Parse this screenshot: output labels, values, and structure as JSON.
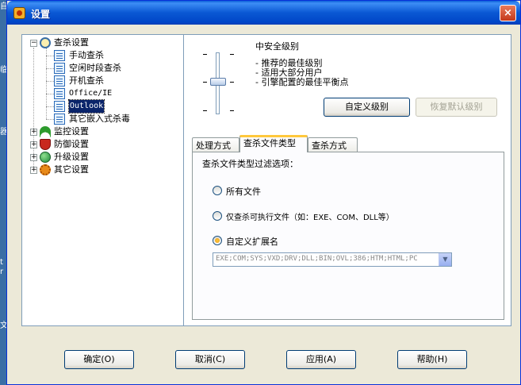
{
  "window": {
    "title": "设置",
    "close_label": "×"
  },
  "tree": {
    "items": [
      {
        "label": "查杀设置",
        "level": 0,
        "expander": "−",
        "icon": "search-icon"
      },
      {
        "label": "手动查杀",
        "level": 1,
        "icon": "document-icon"
      },
      {
        "label": "空闲时段查杀",
        "level": 1,
        "icon": "document-icon"
      },
      {
        "label": "开机查杀",
        "level": 1,
        "icon": "document-icon"
      },
      {
        "label": "Office/IE",
        "level": 1,
        "icon": "document-icon"
      },
      {
        "label": "Outlook",
        "level": 1,
        "icon": "document-icon",
        "selected": true
      },
      {
        "label": "其它嵌入式杀毒",
        "level": 1,
        "icon": "document-icon"
      },
      {
        "label": "监控设置",
        "level": 0,
        "expander": "+",
        "icon": "umbrella-icon"
      },
      {
        "label": "防御设置",
        "level": 0,
        "expander": "+",
        "icon": "shield-icon"
      },
      {
        "label": "升级设置",
        "level": 0,
        "expander": "+",
        "icon": "globe-icon"
      },
      {
        "label": "其它设置",
        "level": 0,
        "expander": "+",
        "icon": "gear-icon"
      }
    ]
  },
  "security_level": {
    "title": "中安全级别",
    "descriptions": [
      "- 推荐的最佳级别",
      "- 适用大部分用户",
      "- 引擎配置的最佳平衡点"
    ],
    "slider_level": "middle",
    "custom_button": "自定义级别",
    "restore_button": "恢复默认级别"
  },
  "tabs": [
    {
      "label": "处理方式"
    },
    {
      "label": "查杀文件类型",
      "active": true
    },
    {
      "label": "查杀方式"
    }
  ],
  "filter": {
    "heading": "查杀文件类型过滤选项：",
    "options": [
      {
        "label": "所有文件",
        "checked": false
      },
      {
        "label": "仅查杀可执行文件（如：EXE、COM、DLL等）",
        "checked": false
      },
      {
        "label": "自定义扩展名",
        "checked": true
      }
    ],
    "extensions_value": "EXE;COM;SYS;VXD;DRV;DLL;BIN;OVL;386;HTM;HTML;PC"
  },
  "footer": {
    "ok": "确定(O)",
    "cancel": "取消(C)",
    "apply": "应用(A)",
    "help": "帮助(H)"
  },
  "desktop_fragments": [
    "自",
    "临",
    "器",
    "t",
    "r",
    "文件"
  ]
}
